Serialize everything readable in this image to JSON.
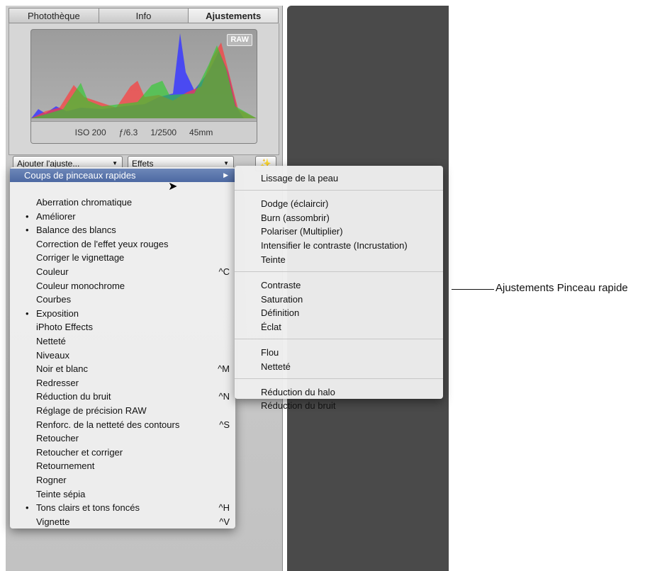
{
  "tabs": [
    "Photothèque",
    "Info",
    "Ajustements"
  ],
  "histogram": {
    "badge": "RAW",
    "exif": {
      "iso": "ISO 200",
      "aperture": "ƒ/6.3",
      "shutter": "1/2500",
      "focal": "45mm"
    }
  },
  "toolbar": {
    "add_adjustment": "Ajouter l'ajuste...",
    "effects": "Effets",
    "wand_icon": "magic-wand-icon"
  },
  "main_menu": {
    "highlighted": "Coups de pinceaux rapides",
    "items": [
      {
        "label": "Aberration chromatique",
        "bullet": "",
        "shortcut": ""
      },
      {
        "label": "Améliorer",
        "bullet": "•",
        "shortcut": ""
      },
      {
        "label": "Balance des blancs",
        "bullet": "•",
        "shortcut": ""
      },
      {
        "label": "Correction de l'effet yeux rouges",
        "bullet": "",
        "shortcut": ""
      },
      {
        "label": "Corriger le vignettage",
        "bullet": "",
        "shortcut": ""
      },
      {
        "label": "Couleur",
        "bullet": "",
        "shortcut": "^C"
      },
      {
        "label": "Couleur monochrome",
        "bullet": "",
        "shortcut": ""
      },
      {
        "label": "Courbes",
        "bullet": "",
        "shortcut": ""
      },
      {
        "label": "Exposition",
        "bullet": "•",
        "shortcut": ""
      },
      {
        "label": "iPhoto Effects",
        "bullet": "",
        "shortcut": ""
      },
      {
        "label": "Netteté",
        "bullet": "",
        "shortcut": ""
      },
      {
        "label": "Niveaux",
        "bullet": "",
        "shortcut": ""
      },
      {
        "label": "Noir et blanc",
        "bullet": "",
        "shortcut": "^M"
      },
      {
        "label": "Redresser",
        "bullet": "",
        "shortcut": ""
      },
      {
        "label": "Réduction du bruit",
        "bullet": "",
        "shortcut": "^N"
      },
      {
        "label": "Réglage de précision RAW",
        "bullet": "",
        "shortcut": ""
      },
      {
        "label": "Renforc. de la netteté des contours",
        "bullet": "",
        "shortcut": "^S"
      },
      {
        "label": "Retoucher",
        "bullet": "",
        "shortcut": ""
      },
      {
        "label": "Retoucher et corriger",
        "bullet": "",
        "shortcut": ""
      },
      {
        "label": "Retournement",
        "bullet": "",
        "shortcut": ""
      },
      {
        "label": "Rogner",
        "bullet": "",
        "shortcut": ""
      },
      {
        "label": "Teinte sépia",
        "bullet": "",
        "shortcut": ""
      },
      {
        "label": "Tons clairs et tons foncés",
        "bullet": "•",
        "shortcut": "^H"
      },
      {
        "label": "Vignette",
        "bullet": "",
        "shortcut": "^V"
      }
    ]
  },
  "sub_menu": {
    "groups": [
      [
        "Lissage de la peau"
      ],
      [
        "Dodge (éclaircir)",
        "Burn (assombrir)",
        "Polariser (Multiplier)",
        "Intensifier le contraste (Incrustation)",
        "Teinte"
      ],
      [
        "Contraste",
        "Saturation",
        "Définition",
        "Éclat"
      ],
      [
        "Flou",
        "Netteté"
      ],
      [
        "Réduction du halo",
        "Réduction du bruit"
      ]
    ]
  },
  "callout": "Ajustements Pinceau rapide"
}
